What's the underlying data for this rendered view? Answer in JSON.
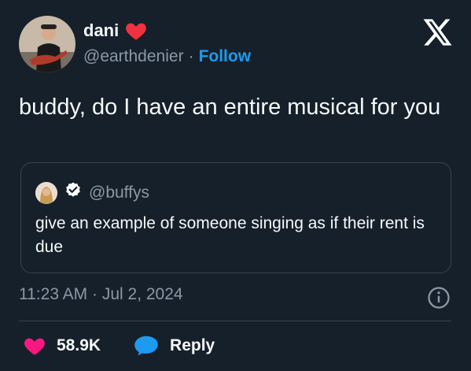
{
  "author": {
    "name": "dani",
    "handle": "@earthdenier",
    "separator": "·",
    "follow_label": "Follow",
    "badge_icon": "red-heart-icon"
  },
  "tweet": {
    "text": "buddy, do I have an entire musical for you"
  },
  "quoted_tweet": {
    "handle": "@buffys",
    "verified_icon": "verified-badge-icon",
    "text": "give an example of someone singing as if their rent is due"
  },
  "meta": {
    "timestamp": "11:23 AM · Jul 2, 2024"
  },
  "actions": {
    "likes_count": "58.9K",
    "reply_label": "Reply"
  },
  "colors": {
    "background": "#15202b",
    "accent": "#1d9bf0",
    "like": "#f91880",
    "muted": "#8b98a5",
    "border": "#38444d"
  }
}
